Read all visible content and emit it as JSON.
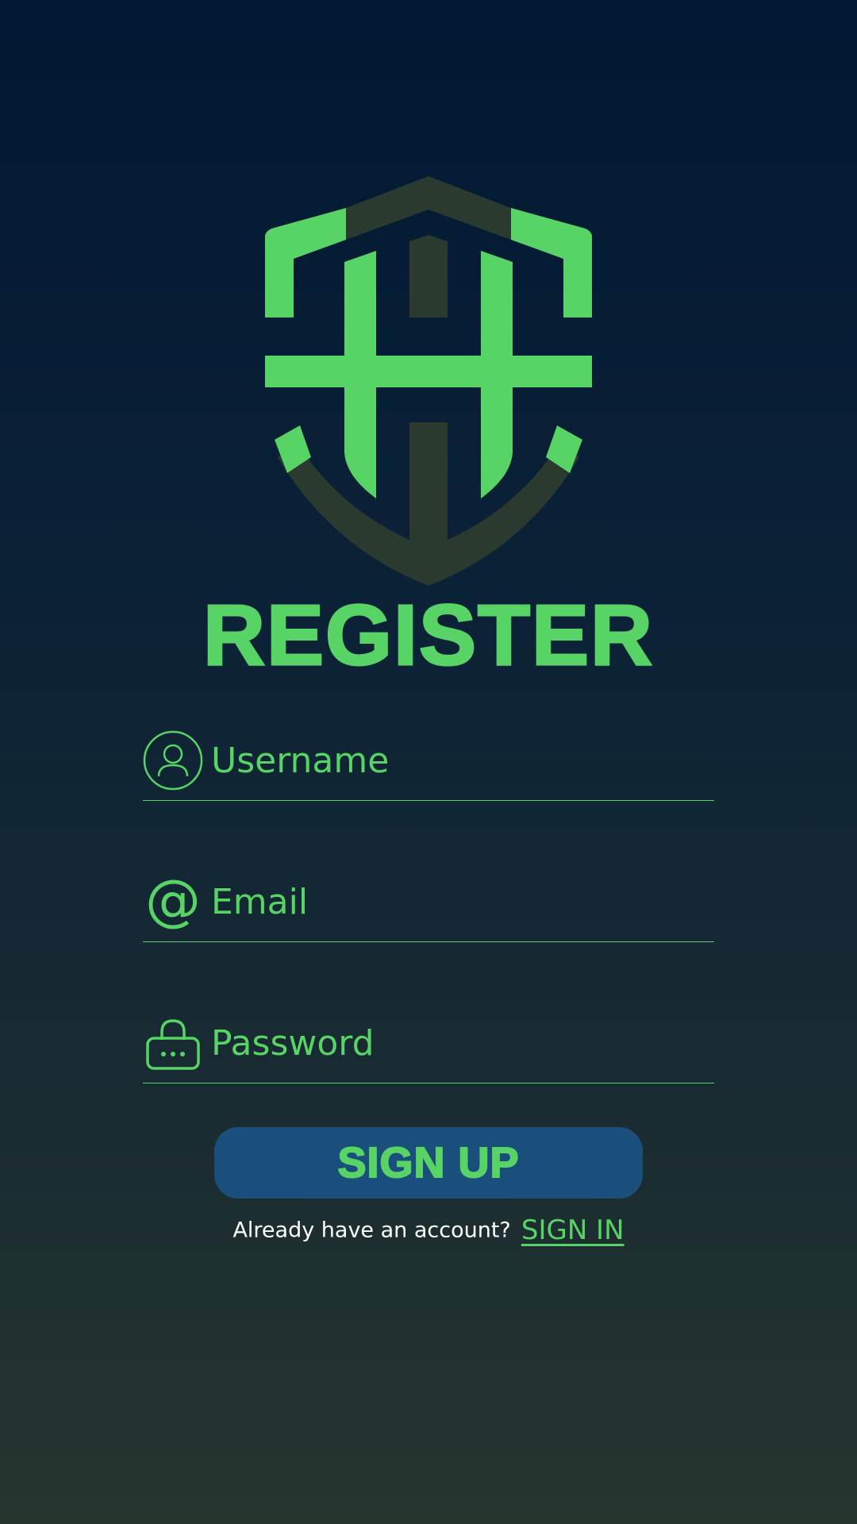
{
  "header": {
    "logo_icon": "shield-logo-icon",
    "title": "REGISTER"
  },
  "form": {
    "username": {
      "placeholder": "Username",
      "value": "",
      "icon": "user-icon"
    },
    "email": {
      "placeholder": "Email",
      "value": "",
      "icon": "at-sign-icon"
    },
    "password": {
      "placeholder": "Password",
      "value": "",
      "icon": "lock-icon"
    }
  },
  "actions": {
    "signup_label": "SIGN UP",
    "signin_prompt": "Already have an account?",
    "signin_label": "SIGN IN"
  },
  "colors": {
    "accent": "#57d465",
    "button_bg": "#1b4f7b",
    "logo_dark": "#2b3a2f",
    "bg_top": "#001833",
    "bg_bottom": "#25362f"
  }
}
